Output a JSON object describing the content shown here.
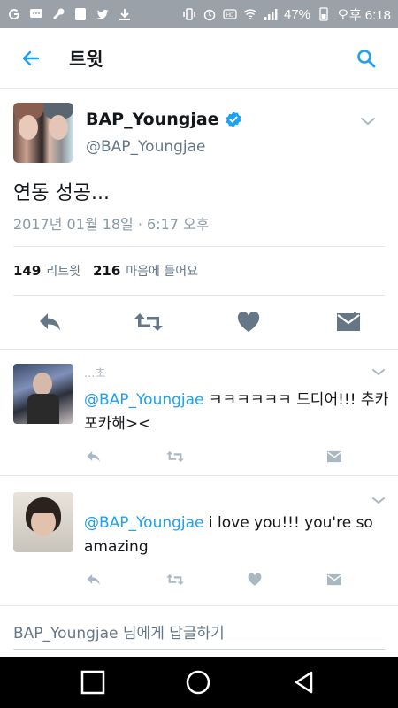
{
  "status_bar": {
    "battery": "47%",
    "time": "오후 6:18",
    "icons": [
      "g-icon",
      "chat-icon",
      "wrench-icon",
      "app-icon",
      "twitter-icon",
      "download-icon",
      "vibrate-icon",
      "alarm-icon",
      "hd-icon",
      "wifi-icon",
      "signal-icon",
      "battery-icon"
    ]
  },
  "app_bar": {
    "title": "트윗"
  },
  "tweet": {
    "display_name": "BAP_Youngjae",
    "handle": "@BAP_Youngjae",
    "text": "연동 성공...",
    "timestamp": "2017년 01월 18일 · 6:17 오후",
    "retweets": "149",
    "retweets_label": "리트윗",
    "likes": "216",
    "likes_label": "마음에 들어요"
  },
  "replies": [
    {
      "name": "",
      "name_fragment": "...초",
      "mention": "@BAP_Youngjae",
      "text": "ㅋㅋㅋㅋㅋㅋ 드디어!!! 추카포카해><"
    },
    {
      "name": "",
      "mention": "@BAP_Youngjae",
      "text": "i love you!!! you're so amazing"
    }
  ],
  "reply_box": {
    "placeholder": "BAP_Youngjae 님에게 답글하기"
  },
  "colors": {
    "accent": "#1da1f2",
    "text": "#14171a",
    "muted": "#657786",
    "icon": "#657786",
    "status_bar": "#9aa1a8"
  }
}
